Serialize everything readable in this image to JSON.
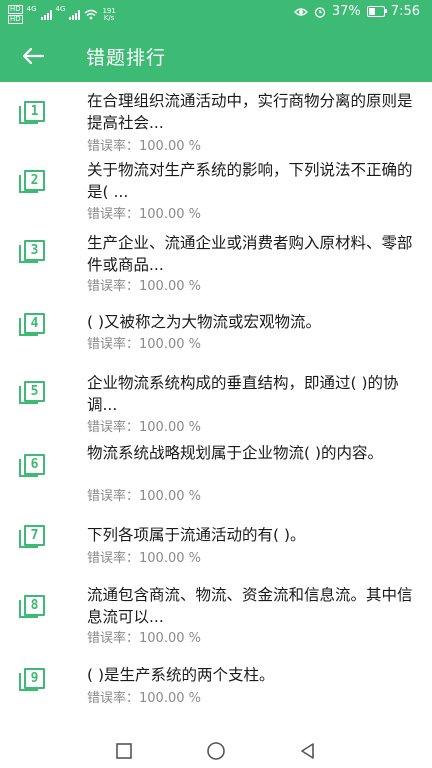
{
  "status_bar": {
    "hd1": "HD",
    "hd2": "HD",
    "sig1_label": "4G",
    "sig2_label": "4G",
    "speed_value": "191",
    "speed_unit": "K/s",
    "battery_percent": "37%",
    "time": "7:56"
  },
  "header": {
    "title": "错题排行"
  },
  "items": [
    {
      "num": "1",
      "text": "在合理组织流通活动中，实行商物分离的原则是提高社会...",
      "rate_label": "错误率：",
      "rate_value": "100.00 %"
    },
    {
      "num": "2",
      "text": "关于物流对生产系统的影响，下列说法不正确的是(  ...",
      "rate_label": "错误率：",
      "rate_value": "100.00 %"
    },
    {
      "num": "3",
      "text": "生产企业、流通企业或消费者购入原材料、零部件或商品...",
      "rate_label": "错误率：",
      "rate_value": "100.00 %"
    },
    {
      "num": "4",
      "text": "(   )又被称之为大物流或宏观物流。",
      "rate_label": "错误率：",
      "rate_value": "100.00 %"
    },
    {
      "num": "5",
      "text": "企业物流系统构成的垂直结构，即通过(   )的协调...",
      "rate_label": "错误率：",
      "rate_value": "100.00 %"
    },
    {
      "num": "6",
      "text": "物流系统战略规划属于企业物流(   )的内容。",
      "rate_label": "错误率：",
      "rate_value": "100.00 %"
    },
    {
      "num": "7",
      "text": "下列各项属于流通活动的有(   )。",
      "rate_label": "错误率：",
      "rate_value": "100.00 %"
    },
    {
      "num": "8",
      "text": "流通包含商流、物流、资金流和信息流。其中信息流可以...",
      "rate_label": "错误率：",
      "rate_value": "100.00 %"
    },
    {
      "num": "9",
      "text": "(   )是生产系统的两个支柱。",
      "rate_label": "错误率：",
      "rate_value": "100.00 %"
    }
  ],
  "colors": {
    "accent": "#3dbb74",
    "text": "#1a1a1a",
    "secondary": "#8a8a8a"
  }
}
